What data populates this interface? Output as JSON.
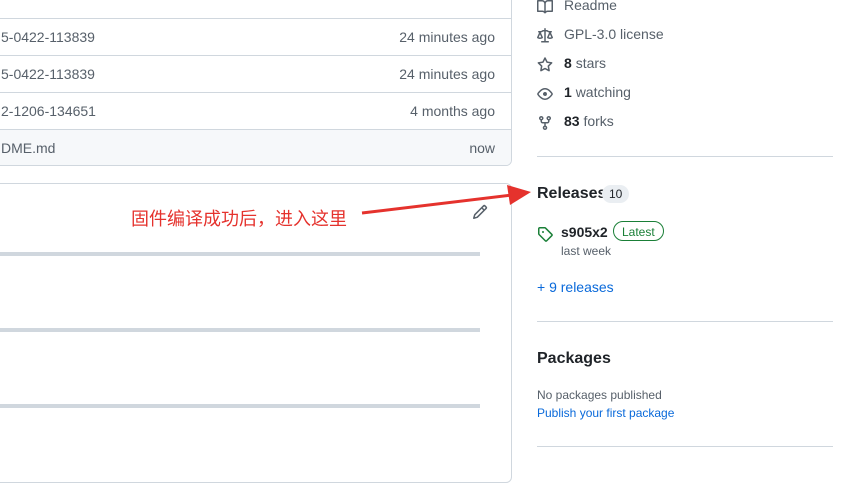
{
  "files": [
    {
      "name": "5-0422-113839",
      "time": "24 minutes ago"
    },
    {
      "name": "5-0422-113839",
      "time": "24 minutes ago"
    },
    {
      "name": "2-1206-134651",
      "time": "4 months ago"
    },
    {
      "name": "DME.md",
      "time": "now"
    }
  ],
  "annotation": {
    "text": "固件编译成功后，进入这里",
    "color": "#e5322d"
  },
  "sidebar": {
    "readme_label": "Readme",
    "license_label": "GPL-3.0 license",
    "stars_count": "8",
    "stars_label": "stars",
    "watching_count": "1",
    "watching_label": "watching",
    "forks_count": "83",
    "forks_label": "forks"
  },
  "releases": {
    "heading": "Releases",
    "count": "10",
    "latest_name": "s905x2",
    "latest_badge": "Latest",
    "latest_date": "last week",
    "more_link": "+ 9 releases"
  },
  "packages": {
    "heading": "Packages",
    "empty_text": "No packages published",
    "publish_link": "Publish your first package"
  },
  "colors": {
    "link": "#0969da",
    "latest": "#1a7f37",
    "border": "#d0d7de"
  },
  "icons": [
    "book-icon",
    "law-icon",
    "star-icon",
    "eye-icon",
    "repo-forked-icon",
    "tag-icon",
    "pencil-icon"
  ]
}
